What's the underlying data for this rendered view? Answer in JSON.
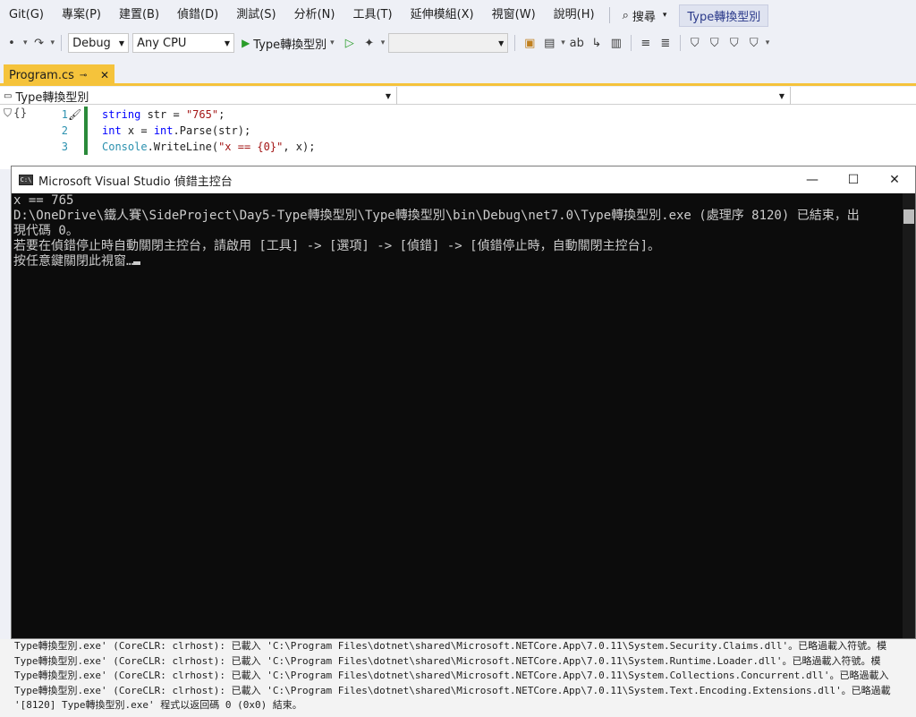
{
  "menubar": {
    "items": [
      "Git(G)",
      "專案(P)",
      "建置(B)",
      "偵錯(D)",
      "測試(S)",
      "分析(N)",
      "工具(T)",
      "延伸模組(X)",
      "視窗(W)",
      "說明(H)"
    ],
    "search_label": "搜尋",
    "solution_title": "Type轉換型別"
  },
  "toolbar": {
    "config": "Debug",
    "platform": "Any CPU",
    "run_target": "Type轉換型別"
  },
  "tabs": {
    "active": "Program.cs"
  },
  "navbar": {
    "project": "Type轉換型別"
  },
  "editor": {
    "line_numbers": [
      "1",
      "2",
      "3"
    ]
  },
  "console": {
    "title": "Microsoft Visual Studio 偵錯主控台",
    "lines": [
      "x == 765",
      "",
      "D:\\OneDrive\\鐵人賽\\SideProject\\Day5-Type轉換型別\\Type轉換型別\\bin\\Debug\\net7.0\\Type轉換型別.exe (處理序 8120) 已結束，出",
      "現代碼 0。",
      "若要在偵錯停止時自動關閉主控台，請啟用 [工具] -> [選項] -> [偵錯] -> [偵錯停止時，自動關閉主控台]。",
      "按任意鍵關閉此視窗…"
    ]
  },
  "output": {
    "lines": [
      "Type轉換型別.exe' (CoreCLR: clrhost): 已載入 'C:\\Program Files\\dotnet\\shared\\Microsoft.NETCore.App\\7.0.11\\System.Security.Claims.dll'。已略過載入符號。模",
      "Type轉換型別.exe' (CoreCLR: clrhost): 已載入 'C:\\Program Files\\dotnet\\shared\\Microsoft.NETCore.App\\7.0.11\\System.Runtime.Loader.dll'。已略過載入符號。模",
      "Type轉換型別.exe' (CoreCLR: clrhost): 已載入 'C:\\Program Files\\dotnet\\shared\\Microsoft.NETCore.App\\7.0.11\\System.Collections.Concurrent.dll'。已略過載入",
      "Type轉換型別.exe' (CoreCLR: clrhost): 已載入 'C:\\Program Files\\dotnet\\shared\\Microsoft.NETCore.App\\7.0.11\\System.Text.Encoding.Extensions.dll'。已略過載",
      "'[8120] Type轉換型別.exe' 程式以返回碼 0 (0x0) 結束。"
    ]
  },
  "colors": {
    "tab_accent": "#f5c33b",
    "console_bg": "#0c0c0c",
    "console_fg": "#cccccc",
    "run_green": "#2a9d2a",
    "change_bar": "#2a8a3a"
  }
}
